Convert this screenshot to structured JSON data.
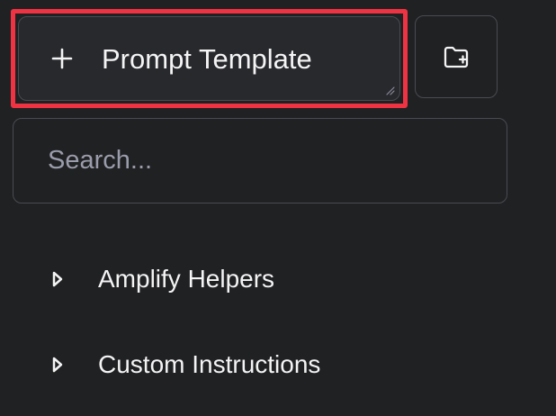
{
  "colors": {
    "background": "#202123",
    "surface": "#28292d",
    "border": "#4a4b52",
    "text": "#f4f4f5",
    "placeholder": "#9a9cab",
    "highlight": "#ef3342"
  },
  "header": {
    "new_template_icon": "plus-icon",
    "new_template_label": "Prompt Template",
    "new_folder_icon": "folder-plus-icon"
  },
  "search": {
    "value": "",
    "placeholder": "Search..."
  },
  "folders": [
    {
      "icon": "caret-right-icon",
      "label": "Amplify Helpers"
    },
    {
      "icon": "caret-right-icon",
      "label": "Custom Instructions"
    }
  ]
}
